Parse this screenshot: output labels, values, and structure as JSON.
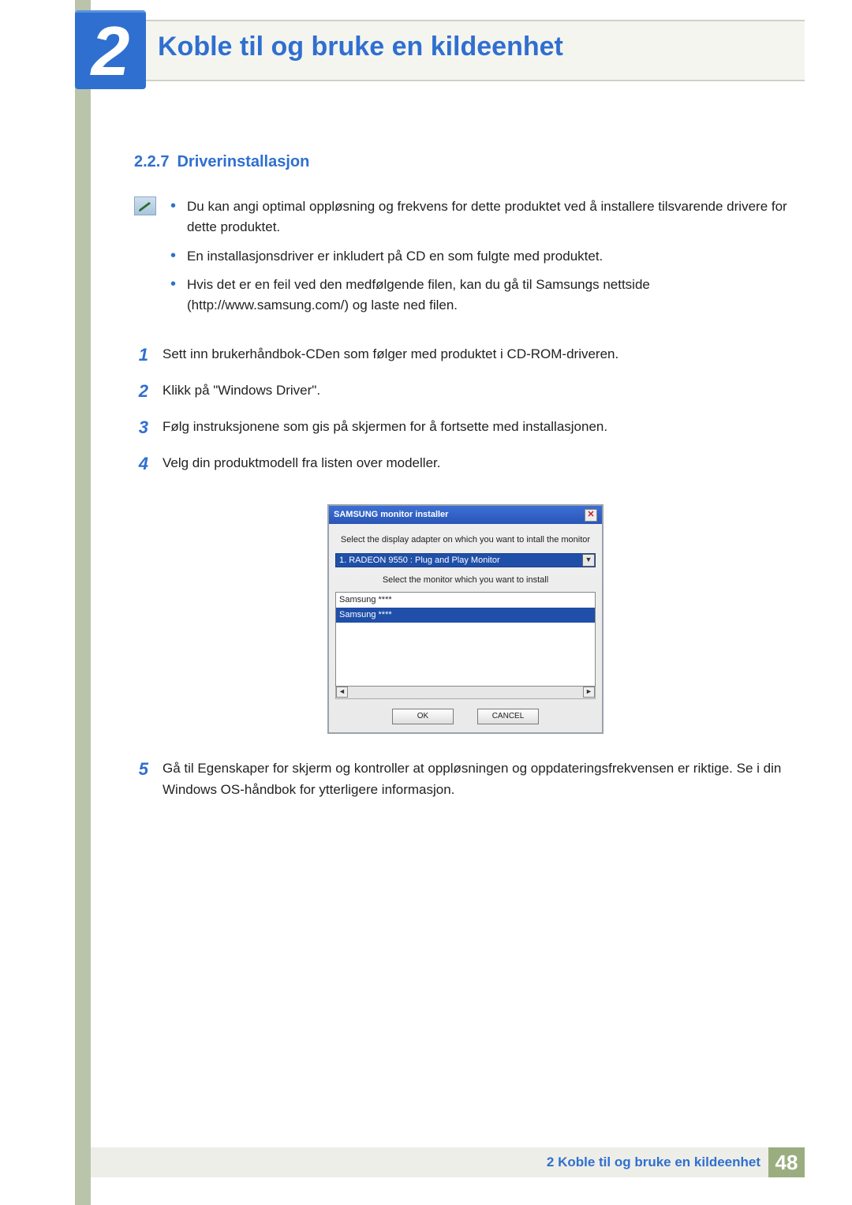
{
  "chapter": {
    "number": "2",
    "title": "Koble til og bruke en kildeenhet"
  },
  "section": {
    "number": "2.2.7",
    "title": "Driverinstallasjon"
  },
  "notes": [
    "Du kan angi optimal oppløsning og frekvens for dette produktet ved å installere tilsvarende drivere for dette produktet.",
    "En installasjonsdriver er inkludert på CD en som fulgte med produktet.",
    "Hvis det er en feil ved den medfølgende filen, kan du gå til Samsungs nettside (http://www.samsung.com/) og laste ned filen."
  ],
  "steps": [
    {
      "n": "1",
      "t": "Sett inn brukerhåndbok-CDen som følger med produktet i CD-ROM-driveren."
    },
    {
      "n": "2",
      "t": "Klikk på \"Windows Driver\"."
    },
    {
      "n": "3",
      "t": "Følg instruksjonene som gis på skjermen for å fortsette med installasjonen."
    },
    {
      "n": "4",
      "t": "Velg din produktmodell fra listen over modeller."
    }
  ],
  "dialog": {
    "title": "SAMSUNG monitor installer",
    "line1": "Select the display adapter on which you want to intall the monitor",
    "selected_adapter": "1. RADEON 9550 : Plug and Play Monitor",
    "line2": "Select the monitor which you want to install",
    "list_item_1": "Samsung ****",
    "list_item_2": "Samsung ****",
    "ok": "OK",
    "cancel": "CANCEL"
  },
  "step5": {
    "n": "5",
    "t": "Gå til Egenskaper for skjerm og kontroller at oppløsningen og oppdateringsfrekvensen er riktige. Se i din Windows OS-håndbok for ytterligere informasjon."
  },
  "footer": {
    "label": "2 Koble til og bruke en kildeenhet",
    "page": "48"
  }
}
